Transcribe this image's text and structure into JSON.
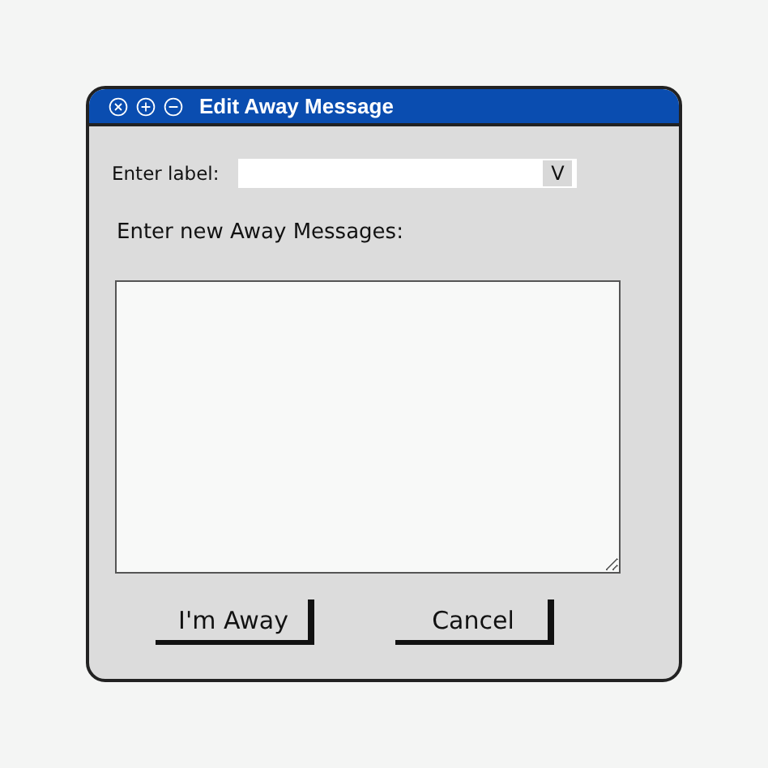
{
  "window": {
    "title": "Edit Away Message"
  },
  "label_field": {
    "label": "Enter label:",
    "dropdown_button": "V"
  },
  "message": {
    "label": "Enter new Away Messages:"
  },
  "buttons": [
    "I'm Away",
    "Cancel"
  ]
}
